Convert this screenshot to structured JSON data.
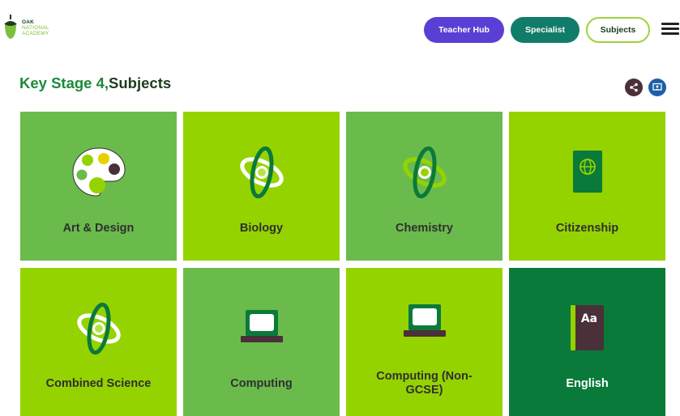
{
  "logo": {
    "line1": "OAK",
    "line2": "NATIONAL",
    "line3": "ACADEMY"
  },
  "nav": {
    "teacher_hub": "Teacher Hub",
    "specialist": "Specialist",
    "subjects": "Subjects"
  },
  "heading": {
    "key_stage": "Key Stage 4,",
    "subjects": "Subjects"
  },
  "cards": [
    {
      "label": "Art & Design",
      "icon": "palette-icon",
      "color": "#6bbb4c"
    },
    {
      "label": "Biology",
      "icon": "atom-icon",
      "color": "#95d300"
    },
    {
      "label": "Chemistry",
      "icon": "atom-icon",
      "color": "#6bbb4c"
    },
    {
      "label": "Citizenship",
      "icon": "passport-icon",
      "color": "#95d300"
    },
    {
      "label": "Combined Science",
      "icon": "atom-icon",
      "color": "#95d300"
    },
    {
      "label": "Computing",
      "icon": "laptop-icon",
      "color": "#6bbb4c"
    },
    {
      "label": "Computing (Non-GCSE)",
      "icon": "laptop-icon",
      "color": "#95d300"
    },
    {
      "label": "English",
      "icon": "book-icon",
      "color": "#0a7a3a"
    }
  ],
  "colors": {
    "teacher_hub": "#5b3fd4",
    "specialist": "#127c6a",
    "brand_green": "#1b8a3a"
  }
}
